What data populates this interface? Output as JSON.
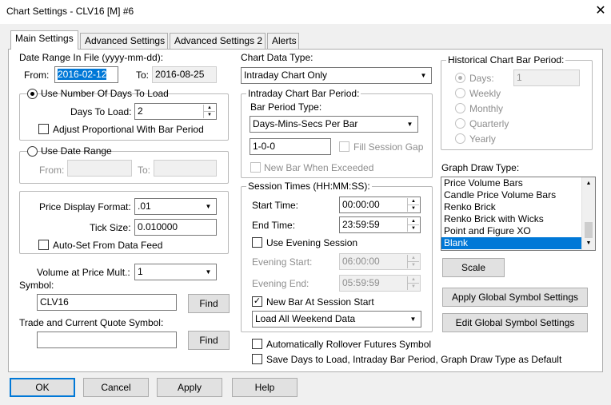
{
  "window": {
    "title": "Chart Settings - CLV16 [M]  #6",
    "close_glyph": "✕"
  },
  "tabs": [
    {
      "label": "Main Settings"
    },
    {
      "label": "Advanced Settings"
    },
    {
      "label": "Advanced Settings 2"
    },
    {
      "label": "Alerts"
    }
  ],
  "date_range": {
    "title": "Date Range In File (yyyy-mm-dd):",
    "from_label": "From:",
    "from_value": "2016-02-12",
    "to_label": "To:",
    "to_value": "2016-08-25"
  },
  "days": {
    "radio_label": "Use Number Of Days To Load",
    "days_label": "Days To Load:",
    "days_value": "2",
    "adjust_label": "Adjust Proportional With Bar Period"
  },
  "date_range_group": {
    "radio_label": "Use Date Range",
    "from_label": "From:",
    "to_label": "To:"
  },
  "price": {
    "format_label": "Price Display Format:",
    "format_value": ".01",
    "tick_label": "Tick Size:",
    "tick_value": "0.010000",
    "autoset_label": "Auto-Set From Data Feed"
  },
  "volume": {
    "label": "Volume at Price Mult.:",
    "value": "1"
  },
  "symbol": {
    "label": "Symbol:",
    "value": "CLV16",
    "find_label": "Find"
  },
  "trade_symbol": {
    "label": "Trade and Current Quote Symbol:",
    "value": "",
    "find_label": "Find"
  },
  "chart_data_type": {
    "label": "Chart Data Type:",
    "value": "Intraday Chart Only"
  },
  "intraday": {
    "title": "Intraday Chart Bar Period:",
    "bar_type_label": "Bar Period Type:",
    "bar_type_value": "Days-Mins-Secs Per Bar",
    "period_value": "1-0-0",
    "fill_gap_label": "Fill Session Gap",
    "new_bar_exceeded_label": "New Bar When Exceeded"
  },
  "session": {
    "title": "Session Times (HH:MM:SS):",
    "start_label": "Start Time:",
    "start_value": "00:00:00",
    "end_label": "End Time:",
    "end_value": "23:59:59",
    "evening_label": "Use Evening Session",
    "evening_start_label": "Evening Start:",
    "evening_start_value": "06:00:00",
    "evening_end_label": "Evening End:",
    "evening_end_value": "05:59:59",
    "new_bar_label": "New Bar At Session Start",
    "weekend_value": "Load All Weekend Data"
  },
  "historical": {
    "title": "Historical Chart Bar Period:",
    "days_label": "Days:",
    "days_value": "1",
    "weekly_label": "Weekly",
    "monthly_label": "Monthly",
    "quarterly_label": "Quarterly",
    "yearly_label": "Yearly"
  },
  "graph_draw": {
    "label": "Graph Draw Type:",
    "items": [
      "Price Volume Bars",
      "Candle Price Volume Bars",
      "Renko Brick",
      "Renko Brick with Wicks",
      "Point and Figure XO",
      "Blank"
    ],
    "selected": "Blank"
  },
  "scale_label": "Scale",
  "apply_global_label": "Apply Global Symbol Settings",
  "edit_global_label": "Edit Global Symbol Settings",
  "rollover_label": "Automatically Rollover Futures Symbol",
  "save_default_label": "Save Days to Load, Intraday Bar Period, Graph Draw Type as Default",
  "buttons": {
    "ok": "OK",
    "cancel": "Cancel",
    "apply": "Apply",
    "help": "Help"
  }
}
